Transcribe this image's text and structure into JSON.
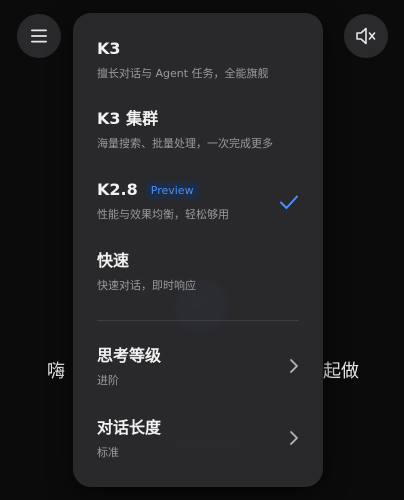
{
  "background": {
    "left_text": "嗨",
    "right_text": "起做"
  },
  "top_bar": {
    "menu_icon": "hamburger-menu-icon",
    "mute_icon": "speaker-muted-icon"
  },
  "model_menu": {
    "items": [
      {
        "title": "K3",
        "desc": "擅长对话与 Agent 任务，全能旗舰"
      },
      {
        "title": "K3 集群",
        "desc": "海量搜索、批量处理，一次完成更多"
      },
      {
        "title": "K2.8",
        "badge": "Preview",
        "desc": "性能与效果均衡，轻松够用",
        "selected": true
      },
      {
        "title": "快速",
        "desc": "快速对话，即时响应"
      }
    ],
    "settings": [
      {
        "title": "思考等级",
        "value": "进阶"
      },
      {
        "title": "对话长度",
        "value": "标准"
      }
    ],
    "accent_color": "#4a90f0"
  }
}
